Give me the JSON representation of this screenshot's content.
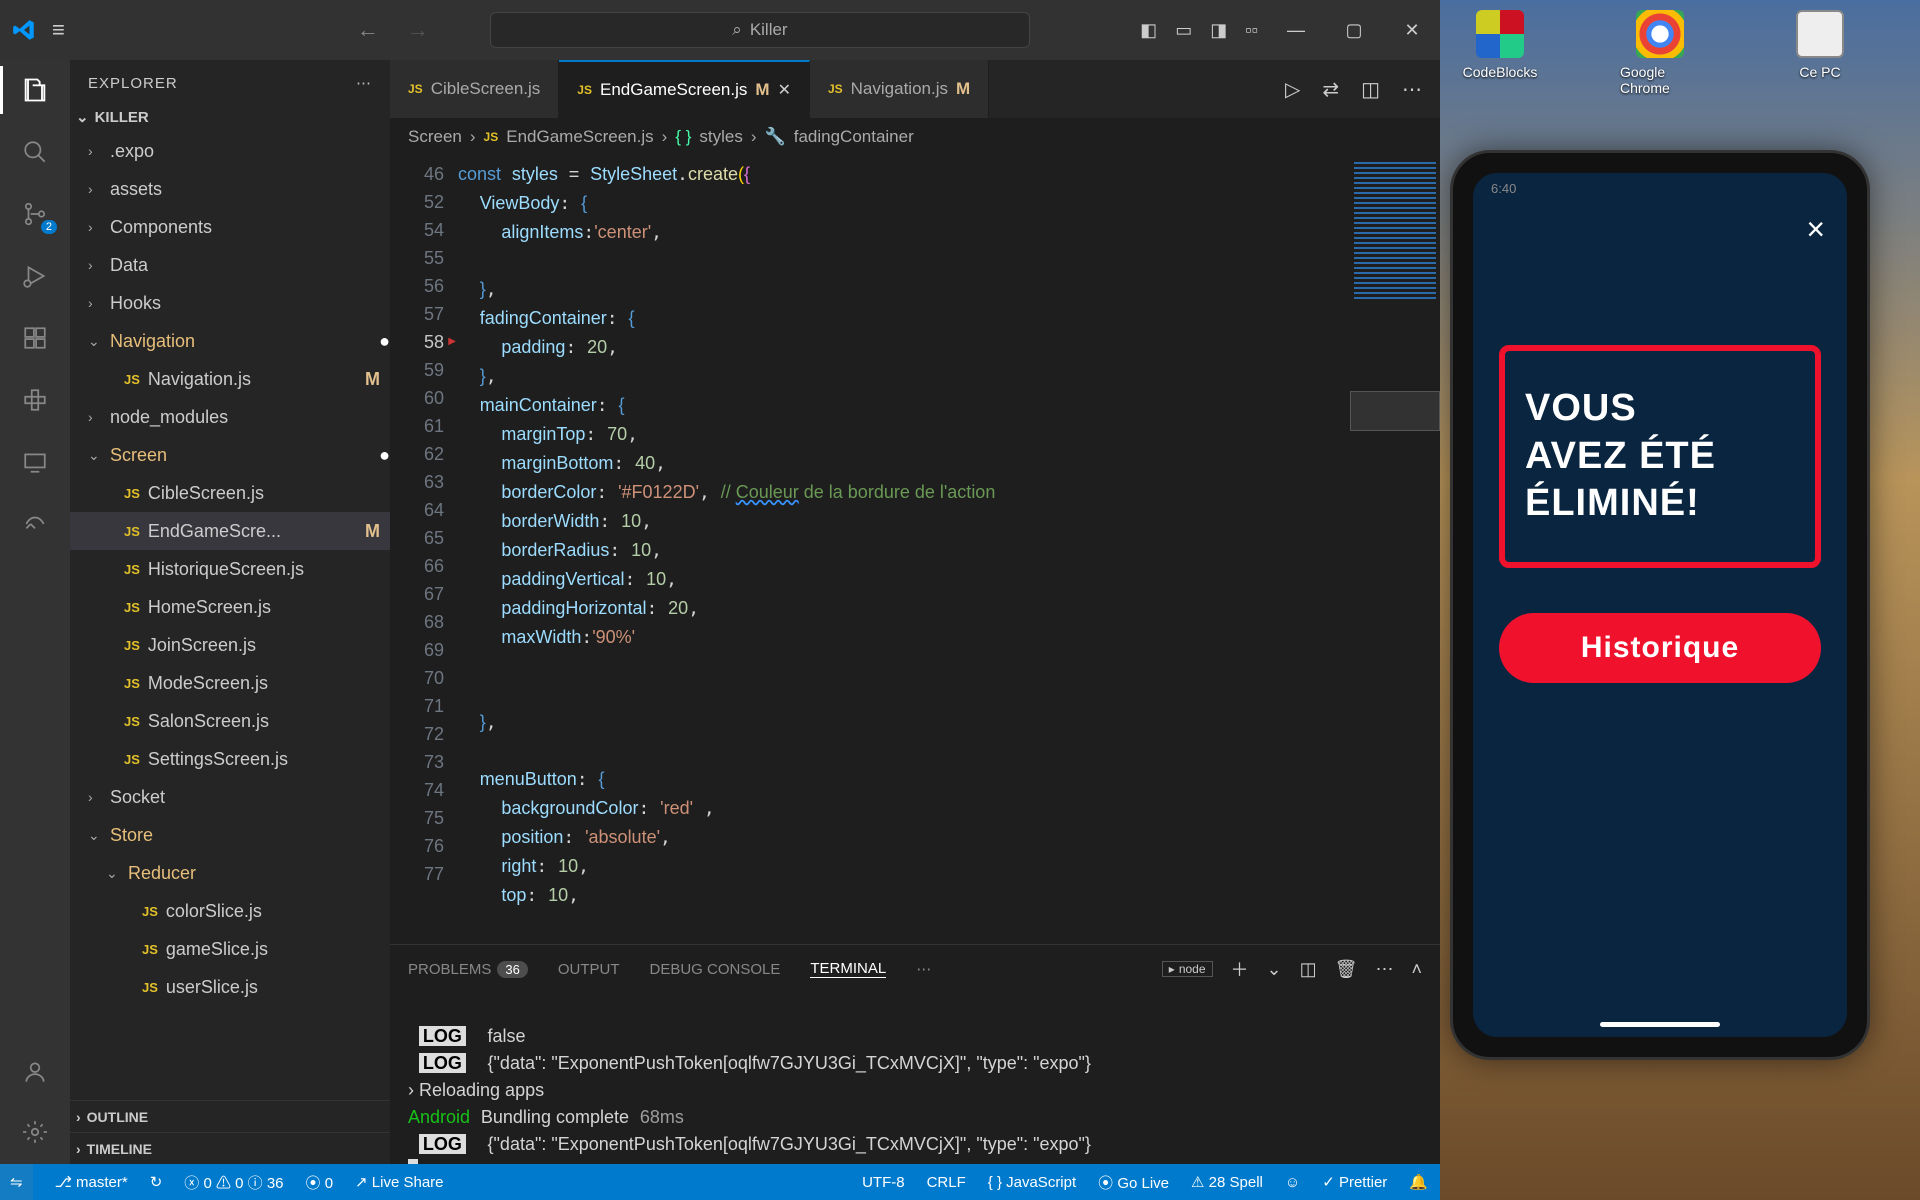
{
  "titlebar": {
    "search_placeholder": "Killer"
  },
  "explorer": {
    "title": "EXPLORER",
    "root": "KILLER",
    "outline": "OUTLINE",
    "timeline": "TIMELINE",
    "tree": [
      {
        "kind": "folder",
        "label": ".expo",
        "level": 1
      },
      {
        "kind": "folder",
        "label": "assets",
        "level": 1
      },
      {
        "kind": "folder",
        "label": "Components",
        "level": 1
      },
      {
        "kind": "folder",
        "label": "Data",
        "level": 1
      },
      {
        "kind": "folder",
        "label": "Hooks",
        "level": 1
      },
      {
        "kind": "folder",
        "label": "Navigation",
        "level": 1,
        "expanded": true,
        "mod": "dot"
      },
      {
        "kind": "file",
        "label": "Navigation.js",
        "level": 2,
        "mod": "M"
      },
      {
        "kind": "folder",
        "label": "node_modules",
        "level": 1
      },
      {
        "kind": "folder",
        "label": "Screen",
        "level": 1,
        "expanded": true,
        "mod": "dot"
      },
      {
        "kind": "file",
        "label": "CibleScreen.js",
        "level": 2
      },
      {
        "kind": "file",
        "label": "EndGameScre...",
        "level": 2,
        "mod": "M",
        "selected": true
      },
      {
        "kind": "file",
        "label": "HistoriqueScreen.js",
        "level": 2
      },
      {
        "kind": "file",
        "label": "HomeScreen.js",
        "level": 2
      },
      {
        "kind": "file",
        "label": "JoinScreen.js",
        "level": 2
      },
      {
        "kind": "file",
        "label": "ModeScreen.js",
        "level": 2
      },
      {
        "kind": "file",
        "label": "SalonScreen.js",
        "level": 2
      },
      {
        "kind": "file",
        "label": "SettingsScreen.js",
        "level": 2
      },
      {
        "kind": "folder",
        "label": "Socket",
        "level": 1
      },
      {
        "kind": "folder",
        "label": "Store",
        "level": 1,
        "expanded": true
      },
      {
        "kind": "folder",
        "label": "Reducer",
        "level": 2,
        "expanded": true
      },
      {
        "kind": "file",
        "label": "colorSlice.js",
        "level": 3
      },
      {
        "kind": "file",
        "label": "gameSlice.js",
        "level": 3
      },
      {
        "kind": "file",
        "label": "userSlice.js",
        "level": 3
      }
    ]
  },
  "tabs": [
    {
      "label": "CibleScreen.js",
      "mod": ""
    },
    {
      "label": "EndGameScreen.js",
      "mod": "M",
      "active": true
    },
    {
      "label": "Navigation.js",
      "mod": "M"
    }
  ],
  "breadcrumbs": {
    "a": "Screen",
    "b": "EndGameScreen.js",
    "c": "styles",
    "d": "fadingContainer"
  },
  "gutter": [
    "46",
    "52",
    "54",
    "55",
    "56",
    "57",
    "58",
    "59",
    "60",
    "61",
    "62",
    "63",
    "64",
    "65",
    "66",
    "67",
    "68",
    "69",
    "70",
    "71",
    "72",
    "73",
    "74",
    "75",
    "76",
    "77"
  ],
  "focus_line_no": "58",
  "panel": {
    "tabs": {
      "problems": "PROBLEMS",
      "output": "OUTPUT",
      "debug": "DEBUG CONSOLE",
      "terminal": "TERMINAL"
    },
    "problems_count": "36",
    "node": "node"
  },
  "term": {
    "l1_v": "false",
    "l2": "{\"data\": \"ExponentPushToken[oqlfw7GJYU3Gi_TCxMVCjX]\", \"type\": \"expo\"}",
    "l3": "› Reloading apps",
    "l4a": "Android",
    "l4b": "Bundling complete",
    "l4c": "68ms",
    "l5": "{\"data\": \"ExponentPushToken[oqlfw7GJYU3Gi_TCxMVCjX]\", \"type\": \"expo\"}"
  },
  "status": {
    "branch": "master*",
    "sync": "↻",
    "err": "0",
    "warn": "0",
    "info": "36",
    "radio": "0",
    "liveshare": "Live Share",
    "enc": "UTF-8",
    "eol": "CRLF",
    "lang": "JavaScript",
    "golive": "Go Live",
    "spell": "28 Spell",
    "prettier": "Prettier"
  },
  "desktop": {
    "codeblocks": "CodeBlocks",
    "chrome": "Google Chrome",
    "pc": "Ce PC"
  },
  "phone": {
    "time": "6:40",
    "card_l1": "Vous",
    "card_l2": "Avez été",
    "card_l3": "éliminé!",
    "button": "Historique"
  },
  "activity_badge": "2"
}
